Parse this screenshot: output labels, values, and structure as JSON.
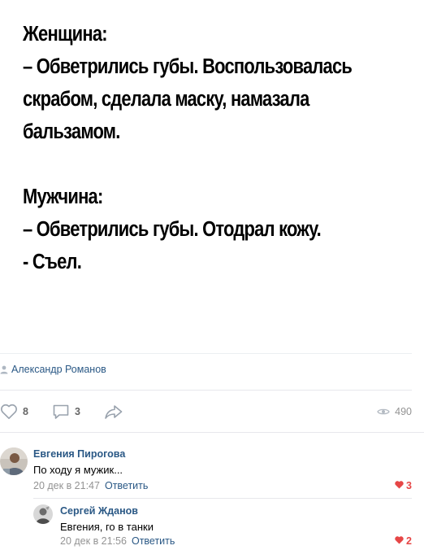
{
  "post": {
    "meme_text": "Женщина:\n– Обветрились губы. Воспользовалась\nскрабом, сделала маску, намазала\nбальзамом.\n\nМужчина:\n– Обветрились губы. Отодрал кожу.\n- Съел.",
    "author": "Александр Романов"
  },
  "actions": {
    "likes": "8",
    "comments": "3",
    "views": "490"
  },
  "comments": [
    {
      "author": "Евгения Пирогова",
      "text": "По ходу я мужик...",
      "time": "20 дек в 21:47",
      "reply_label": "Ответить",
      "likes": "3"
    },
    {
      "author": "Сергей Жданов",
      "text": "Евгения, го в танки",
      "time": "20 дек в 21:56",
      "reply_label": "Ответить",
      "likes": "2"
    }
  ],
  "colors": {
    "link": "#2a5885",
    "meta": "#939393",
    "like_red": "#e64646",
    "divider": "#e7e8ec"
  }
}
